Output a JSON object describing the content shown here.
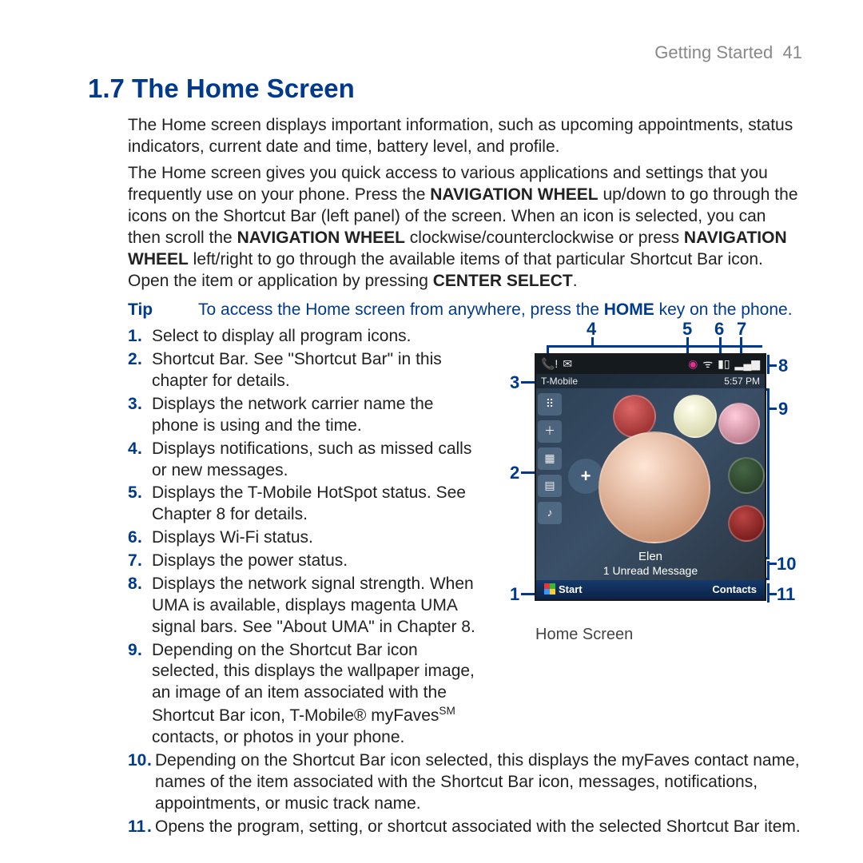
{
  "header": {
    "section": "Getting Started",
    "page_no": "41"
  },
  "title": "1.7  The Home Screen",
  "intro": {
    "p1": "The Home screen displays important information, such as upcoming appointments, status indicators, current date and time, battery level, and profile.",
    "p2a": "The Home screen gives you quick access to various applications and settings that you frequently use on your phone. Press the ",
    "p2b": "NAVIGATION WHEEL",
    "p2c": " up/down to go through the icons on the Shortcut Bar (left panel) of the screen. When an icon is selected, you can then scroll the ",
    "p2d": "NAVIGATION WHEEL",
    "p2e": " clockwise/counterclockwise or press ",
    "p2f": "NAVIGATION WHEEL",
    "p2g": " left/right to go through the available items of that particular Shortcut Bar icon. Open the item or application by pressing ",
    "p2h": "CENTER SELECT",
    "p2i": "."
  },
  "tip": {
    "label": "Tip",
    "text_a": "To access the Home screen from anywhere, press the ",
    "text_b": "HOME",
    "text_c": " key on the phone."
  },
  "list": {
    "i1": "Select to display all program icons.",
    "i2": "Shortcut Bar. See \"Shortcut Bar\" in this chapter for details.",
    "i3": "Displays the network carrier name the phone is using and the time.",
    "i4": "Displays notifications, such as missed calls or new messages.",
    "i5": "Displays the T-Mobile HotSpot status. See Chapter 8 for details.",
    "i6": "Displays Wi-Fi status.",
    "i7": "Displays the power status.",
    "i8": "Displays the network signal strength. When UMA is available, displays magenta UMA signal bars. See \"About UMA\" in Chapter 8.",
    "i9a": "Depending on the Shortcut Bar icon selected, this displays the wallpaper image, an image of an item associated with the Shortcut Bar icon, T-Mobile",
    "i9b": " myFaves",
    "i9c": " contacts, or photos in your phone.",
    "i10": "Depending on the Shortcut Bar icon selected, this displays the myFaves contact name, names of the item associated with the Shortcut Bar icon, messages, notifications, appointments, or music track name.",
    "i11": "Opens the program, setting, or shortcut associated with the selected Shortcut Bar item."
  },
  "phone": {
    "carrier": "T-Mobile",
    "time": "5:57 PM",
    "contact_name": "Elen",
    "contact_sub": "1 Unread Message",
    "soft_left": "Start",
    "soft_right": "Contacts"
  },
  "figure_caption": "Home Screen",
  "labels": {
    "n1": "1",
    "n2": "2",
    "n3": "3",
    "n4": "4",
    "n5": "5",
    "n6": "6",
    "n7": "7",
    "n8": "8",
    "n9": "9",
    "n10": "10",
    "n11": "11"
  }
}
